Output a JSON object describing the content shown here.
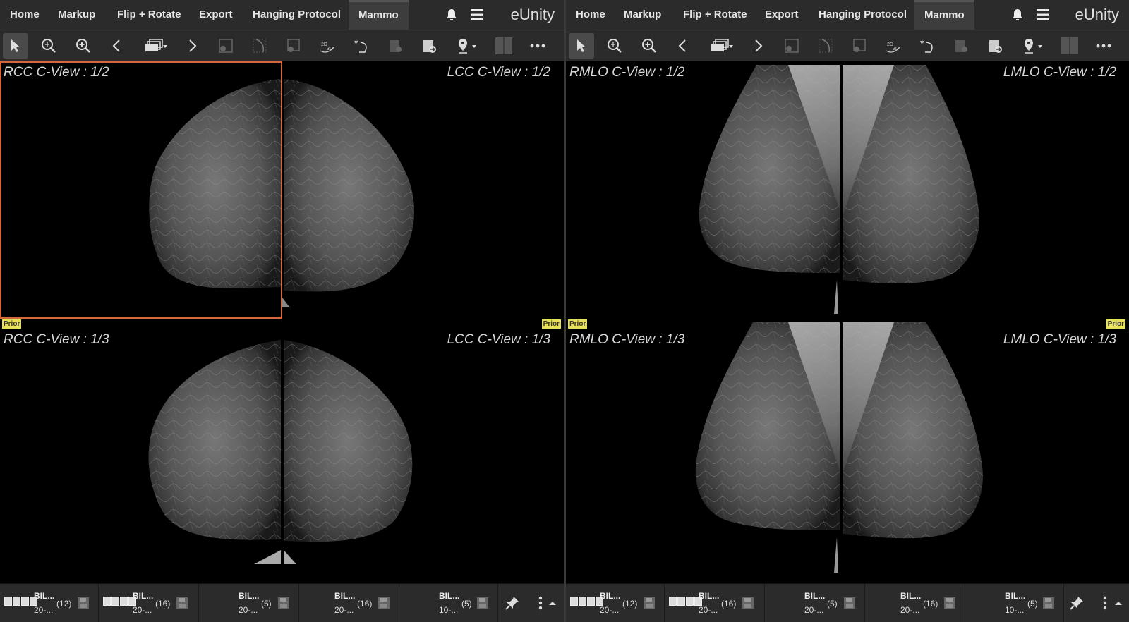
{
  "menu": {
    "tabs": [
      "Home",
      "Markup",
      "Flip + Rotate",
      "Export",
      "Hanging Protocol",
      "Mammo"
    ],
    "active_tab": "Mammo",
    "brand": "eUnity"
  },
  "toolbar": {
    "tools": [
      "pointer-icon",
      "zoom-fit-icon",
      "zoom-in-icon",
      "chevron-left-icon",
      "stack-icon",
      "chevron-right-icon",
      "shutter-icon",
      "curve-icon",
      "roi-icon",
      "2d-3d-icon",
      "spot-icon",
      "paste-icon",
      "paste-arrow-icon",
      "location-pin-icon",
      "layout-icon",
      "more-icon"
    ]
  },
  "panes": {
    "left": {
      "top_left_label": "RCC C-View : 1/2",
      "top_right_label": "LCC C-View : 1/2",
      "bottom_left_label": "RCC C-View : 1/3",
      "bottom_right_label": "LCC C-View : 1/3",
      "prior_left": "Prior",
      "prior_right": "Prior"
    },
    "right": {
      "top_left_label": "RMLO C-View : 1/2",
      "top_right_label": "LMLO C-View : 1/2",
      "bottom_left_label": "RMLO C-View : 1/3",
      "bottom_right_label": "LMLO C-View : 1/3",
      "prior_left": "Prior",
      "prior_right": "Prior"
    }
  },
  "series_left": [
    {
      "name": "BIL...",
      "date": "20-...",
      "count": "(12)"
    },
    {
      "name": "BIL...",
      "date": "20-...",
      "count": "(16)"
    },
    {
      "name": "BIL...",
      "date": "20-...",
      "count": "(5)"
    },
    {
      "name": "BIL...",
      "date": "20-...",
      "count": "(16)"
    },
    {
      "name": "BIL...",
      "date": "10-...",
      "count": "(5)"
    }
  ],
  "series_right": [
    {
      "name": "BIL...",
      "date": "20-...",
      "count": "(12)"
    },
    {
      "name": "BIL...",
      "date": "20-...",
      "count": "(16)"
    },
    {
      "name": "BIL...",
      "date": "20-...",
      "count": "(5)"
    },
    {
      "name": "BIL...",
      "date": "20-...",
      "count": "(16)"
    },
    {
      "name": "BIL...",
      "date": "10-...",
      "count": "(5)"
    }
  ],
  "colors": {
    "selection": "#d2693c",
    "prior_badge": "#e6e05a",
    "bar": "#2b2b2b"
  }
}
